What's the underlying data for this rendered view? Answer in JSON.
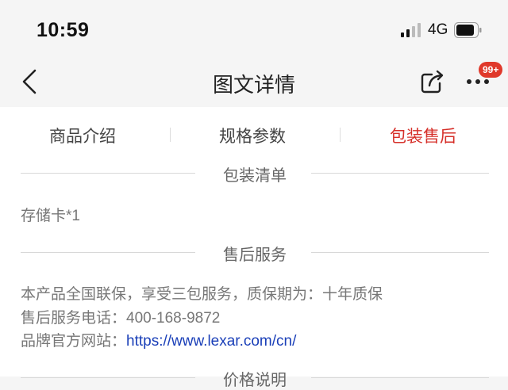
{
  "status_bar": {
    "time": "10:59",
    "network": "4G"
  },
  "nav": {
    "title": "图文详情",
    "badge": "99+"
  },
  "tabs": [
    {
      "label": "商品介绍",
      "active": false
    },
    {
      "label": "规格参数",
      "active": false
    },
    {
      "label": "包装售后",
      "active": true
    }
  ],
  "sections": {
    "packing": {
      "title": "包装清单",
      "items": [
        "存储卡*1"
      ]
    },
    "after_sales": {
      "title": "售后服务",
      "warranty": "本产品全国联保，享受三包服务，质保期为：十年质保",
      "phone_label": "售后服务电话：",
      "phone": "400-168-9872",
      "site_label": "品牌官方网站：",
      "site_url": "https://www.lexar.com/cn/"
    },
    "price": {
      "title": "价格说明"
    }
  },
  "colors": {
    "accent": "#d6302a",
    "link": "#1a3fb8",
    "badge": "#e0392b"
  }
}
